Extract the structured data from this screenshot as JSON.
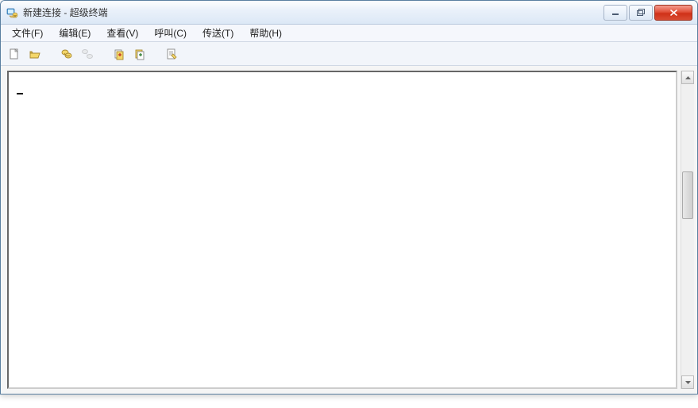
{
  "window": {
    "title": "新建连接 - 超级终端"
  },
  "menu": {
    "items": [
      {
        "label": "文件(F)",
        "name": "menu-file"
      },
      {
        "label": "编辑(E)",
        "name": "menu-edit"
      },
      {
        "label": "查看(V)",
        "name": "menu-view"
      },
      {
        "label": "呼叫(C)",
        "name": "menu-call"
      },
      {
        "label": "传送(T)",
        "name": "menu-transfer"
      },
      {
        "label": "帮助(H)",
        "name": "menu-help"
      }
    ]
  },
  "toolbar": {
    "items": [
      {
        "name": "new-icon"
      },
      {
        "name": "open-icon"
      },
      {
        "name": "connect-icon"
      },
      {
        "name": "disconnect-icon"
      },
      {
        "name": "send-icon"
      },
      {
        "name": "receive-icon"
      },
      {
        "name": "properties-icon"
      }
    ]
  },
  "terminal": {
    "content": ""
  }
}
